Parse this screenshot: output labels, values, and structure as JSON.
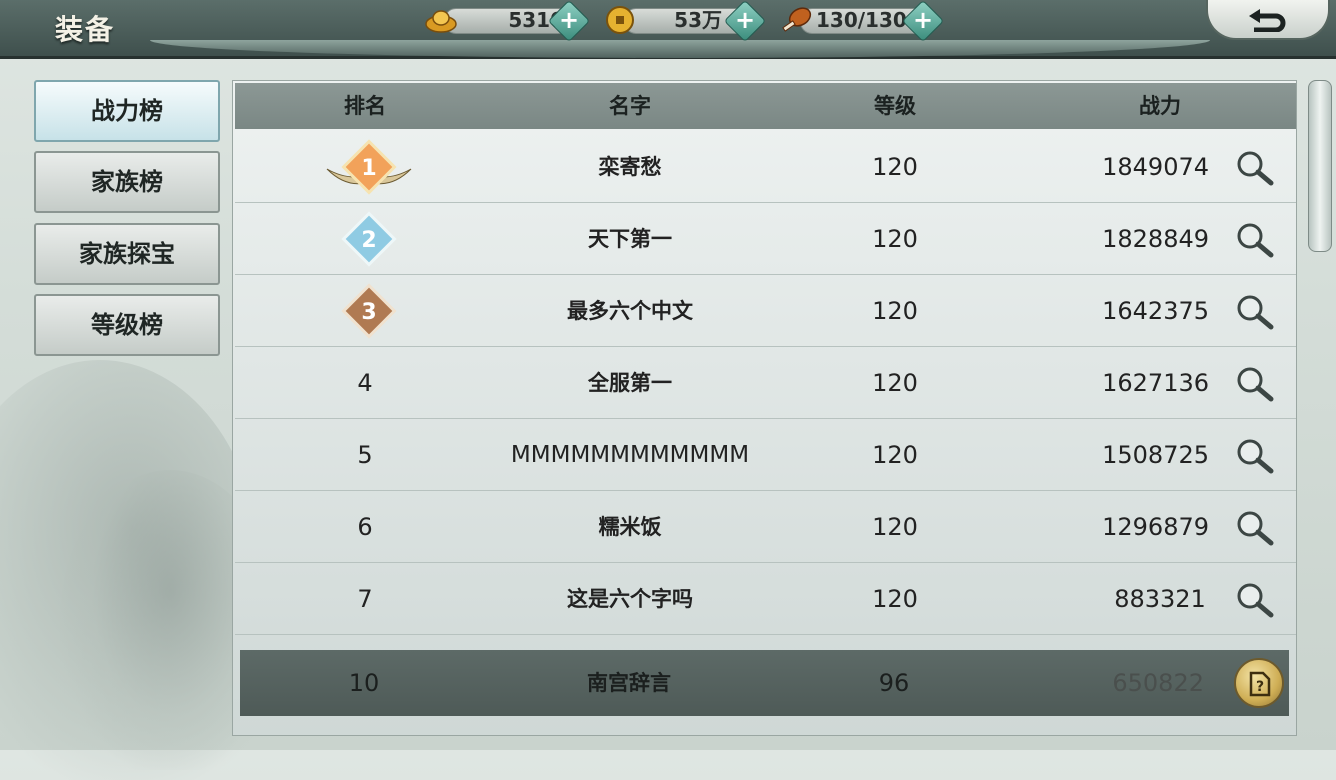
{
  "header": {
    "title": "装备",
    "resources": [
      {
        "name": "gold-ingot",
        "value": "5310"
      },
      {
        "name": "coin",
        "value": "53万"
      },
      {
        "name": "stamina-meat",
        "value": "130/130"
      }
    ]
  },
  "sidebar": {
    "tabs": [
      {
        "label": "战力榜",
        "active": true
      },
      {
        "label": "家族榜",
        "active": false
      },
      {
        "label": "家族探宝",
        "active": false
      },
      {
        "label": "等级榜",
        "active": false
      }
    ]
  },
  "table": {
    "headers": {
      "rank": "排名",
      "name": "名字",
      "level": "等级",
      "power": "战力"
    },
    "rows": [
      {
        "rank": "1",
        "name": "栾寄愁",
        "level": "120",
        "power": "1849074"
      },
      {
        "rank": "2",
        "name": "天下第一",
        "level": "120",
        "power": "1828849"
      },
      {
        "rank": "3",
        "name": "最多六个中文",
        "level": "120",
        "power": "1642375"
      },
      {
        "rank": "4",
        "name": "全服第一",
        "level": "120",
        "power": "1627136"
      },
      {
        "rank": "5",
        "name": "MMMMMMMMMMMM",
        "level": "120",
        "power": "1508725"
      },
      {
        "rank": "6",
        "name": "糯米饭",
        "level": "120",
        "power": "1296879"
      },
      {
        "rank": "7",
        "name": "这是六个字吗",
        "level": "120",
        "power": "883321"
      }
    ],
    "my_row": {
      "rank": "10",
      "name": "南宫辞言",
      "level": "96",
      "power": "650822"
    }
  },
  "colors": {
    "medal_gold": "#e8803a",
    "medal_silver": "#7ec4e0",
    "medal_bronze": "#a8734c"
  }
}
